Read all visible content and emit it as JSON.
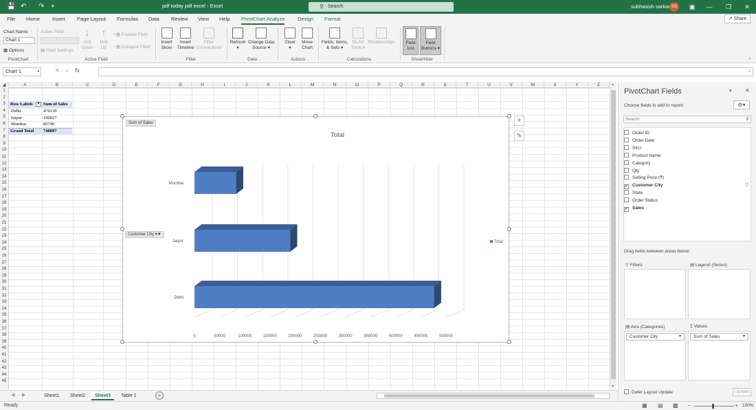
{
  "title_bar": {
    "doc_title": "pdf today pdf excel  -  Excel",
    "search_placeholder": "Search",
    "user_name": "subhasish sarkar",
    "user_initials": "SS"
  },
  "ribbon_tabs": [
    "File",
    "Home",
    "Insert",
    "Page Layout",
    "Formulas",
    "Data",
    "Review",
    "View",
    "Help",
    "PivotChart Analyze",
    "Design",
    "Format"
  ],
  "share_label": "Share",
  "ribbon": {
    "chart_name_label": "Chart Name:",
    "chart_name_value": "Chart 1",
    "options_label": "Options",
    "active_field_label": "Active Field:",
    "field_settings": "Field Settings",
    "drill_down": [
      "Drill",
      "Down"
    ],
    "drill_up": [
      "Drill",
      "Up"
    ],
    "expand_field": "Expand Field",
    "collapse_field": "Collapse Field",
    "insert_slicer": [
      "Insert",
      "Slicer"
    ],
    "insert_timeline": [
      "Insert",
      "Timeline"
    ],
    "filter_connections": [
      "Filter",
      "Connections"
    ],
    "refresh": "Refresh",
    "change_data_source": [
      "Change Data",
      "Source"
    ],
    "clear": "Clear",
    "move_chart": [
      "Move",
      "Chart"
    ],
    "fields_items_sets": [
      "Fields, Items,",
      "& Sets"
    ],
    "olap_tools": [
      "OLAP",
      "Tools"
    ],
    "relationships": "Relationships",
    "field_list": [
      "Field",
      "List"
    ],
    "field_buttons": [
      "Field",
      "Buttons"
    ],
    "groups": [
      "PivotChart",
      "Active Field",
      "Filter",
      "Data",
      "Actions",
      "Calculations",
      "Show/Hide"
    ]
  },
  "formula_bar": {
    "name_box": "Chart 1",
    "fx": "fx"
  },
  "columns": [
    "A",
    "B",
    "C",
    "D",
    "E",
    "F",
    "G",
    "H",
    "I",
    "J",
    "K",
    "L",
    "M",
    "N",
    "O",
    "P",
    "Q",
    "R",
    "S",
    "T",
    "U",
    "V",
    "W",
    "X",
    "Y",
    "Z"
  ],
  "pivot_table": {
    "header_row_labels": "Row Labels",
    "header_sum": "Sum of Sales",
    "rows": [
      {
        "label": "Delhi",
        "value": "476130"
      },
      {
        "label": "Jaipur",
        "value": "190027"
      },
      {
        "label": "Mumbai",
        "value": "82740"
      }
    ],
    "grand_total_label": "Grand Total",
    "grand_total_value": "748897"
  },
  "chart_data": {
    "type": "bar",
    "title": "Total",
    "categories": [
      "Delhi",
      "Jaipur",
      "Mumbai"
    ],
    "series": [
      {
        "name": "Total",
        "values": [
          476130,
          190027,
          82740
        ]
      }
    ],
    "xlim": [
      0,
      500000
    ],
    "x_ticks": [
      0,
      50000,
      100000,
      150000,
      200000,
      250000,
      300000,
      350000,
      400000,
      450000,
      500000
    ],
    "legend_position": "right",
    "bar_color": "#4f7ec4",
    "grid": true,
    "three_d": true,
    "value_field_button": "Sum of Sales",
    "axis_field_button": "Customer City"
  },
  "sheet_tabs": [
    "Sheet1",
    "Sheet2",
    "Sheet3",
    "Table 1"
  ],
  "active_sheet": "Sheet3",
  "status": {
    "ready": "Ready",
    "zoom": "100%"
  },
  "pane": {
    "title": "PivotChart Fields",
    "subtitle": "Choose fields to add to report:",
    "search_placeholder": "Search",
    "fields": [
      {
        "name": "Order ID",
        "checked": false
      },
      {
        "name": "Order Date",
        "checked": false
      },
      {
        "name": "SKU",
        "checked": false
      },
      {
        "name": "Product Name",
        "checked": false
      },
      {
        "name": "Category",
        "checked": false
      },
      {
        "name": "Qty",
        "checked": false
      },
      {
        "name": "Selling Price (₹)",
        "checked": false
      },
      {
        "name": "Customer City",
        "checked": true
      },
      {
        "name": "State",
        "checked": false
      },
      {
        "name": "Order Status",
        "checked": false
      },
      {
        "name": "Sales",
        "checked": true
      }
    ],
    "drag_hint": "Drag fields between areas below:",
    "filters_label": "Filters",
    "legend_label": "Legend (Series)",
    "axis_label": "Axis (Categories)",
    "values_label": "Values",
    "axis_item": "Customer City",
    "values_item": "Sum of Sales",
    "defer_label": "Defer Layout Update",
    "update_button": "Update"
  }
}
